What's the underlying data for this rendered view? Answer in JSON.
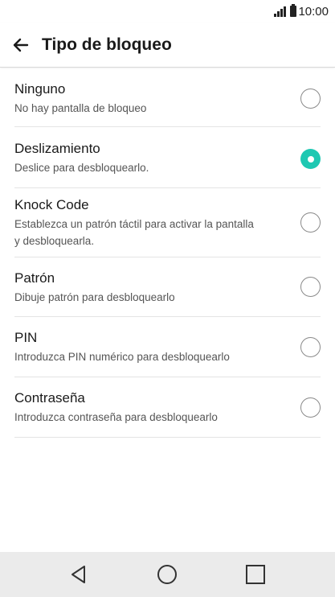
{
  "status_bar": {
    "time": "10:00",
    "icons": [
      "signal-icon",
      "battery-icon"
    ]
  },
  "app_bar": {
    "title": "Tipo de bloqueo",
    "back_icon": "arrow-left-icon"
  },
  "options": [
    {
      "title": "Ninguno",
      "description": "No hay pantalla de bloqueo",
      "selected": false
    },
    {
      "title": "Deslizamiento",
      "description": "Deslice para desbloquearlo.",
      "selected": true
    },
    {
      "title": "Knock Code",
      "description": "Establezca un patrón táctil para activar la pantalla y desbloquearla.",
      "selected": false
    },
    {
      "title": "Patrón",
      "description": "Dibuje patrón para desbloquearlo",
      "selected": false
    },
    {
      "title": "PIN",
      "description": "Introduzca PIN numérico para desbloquearlo",
      "selected": false
    },
    {
      "title": "Contraseña",
      "description": "Introduzca contraseña para desbloquearlo",
      "selected": false
    }
  ],
  "nav_bar": {
    "buttons": [
      "back-triangle-icon",
      "home-circle-icon",
      "recents-square-icon"
    ]
  },
  "colors": {
    "accent": "#1ec8b2",
    "nav_background": "#ebebeb",
    "divider": "#e4e4e4"
  }
}
